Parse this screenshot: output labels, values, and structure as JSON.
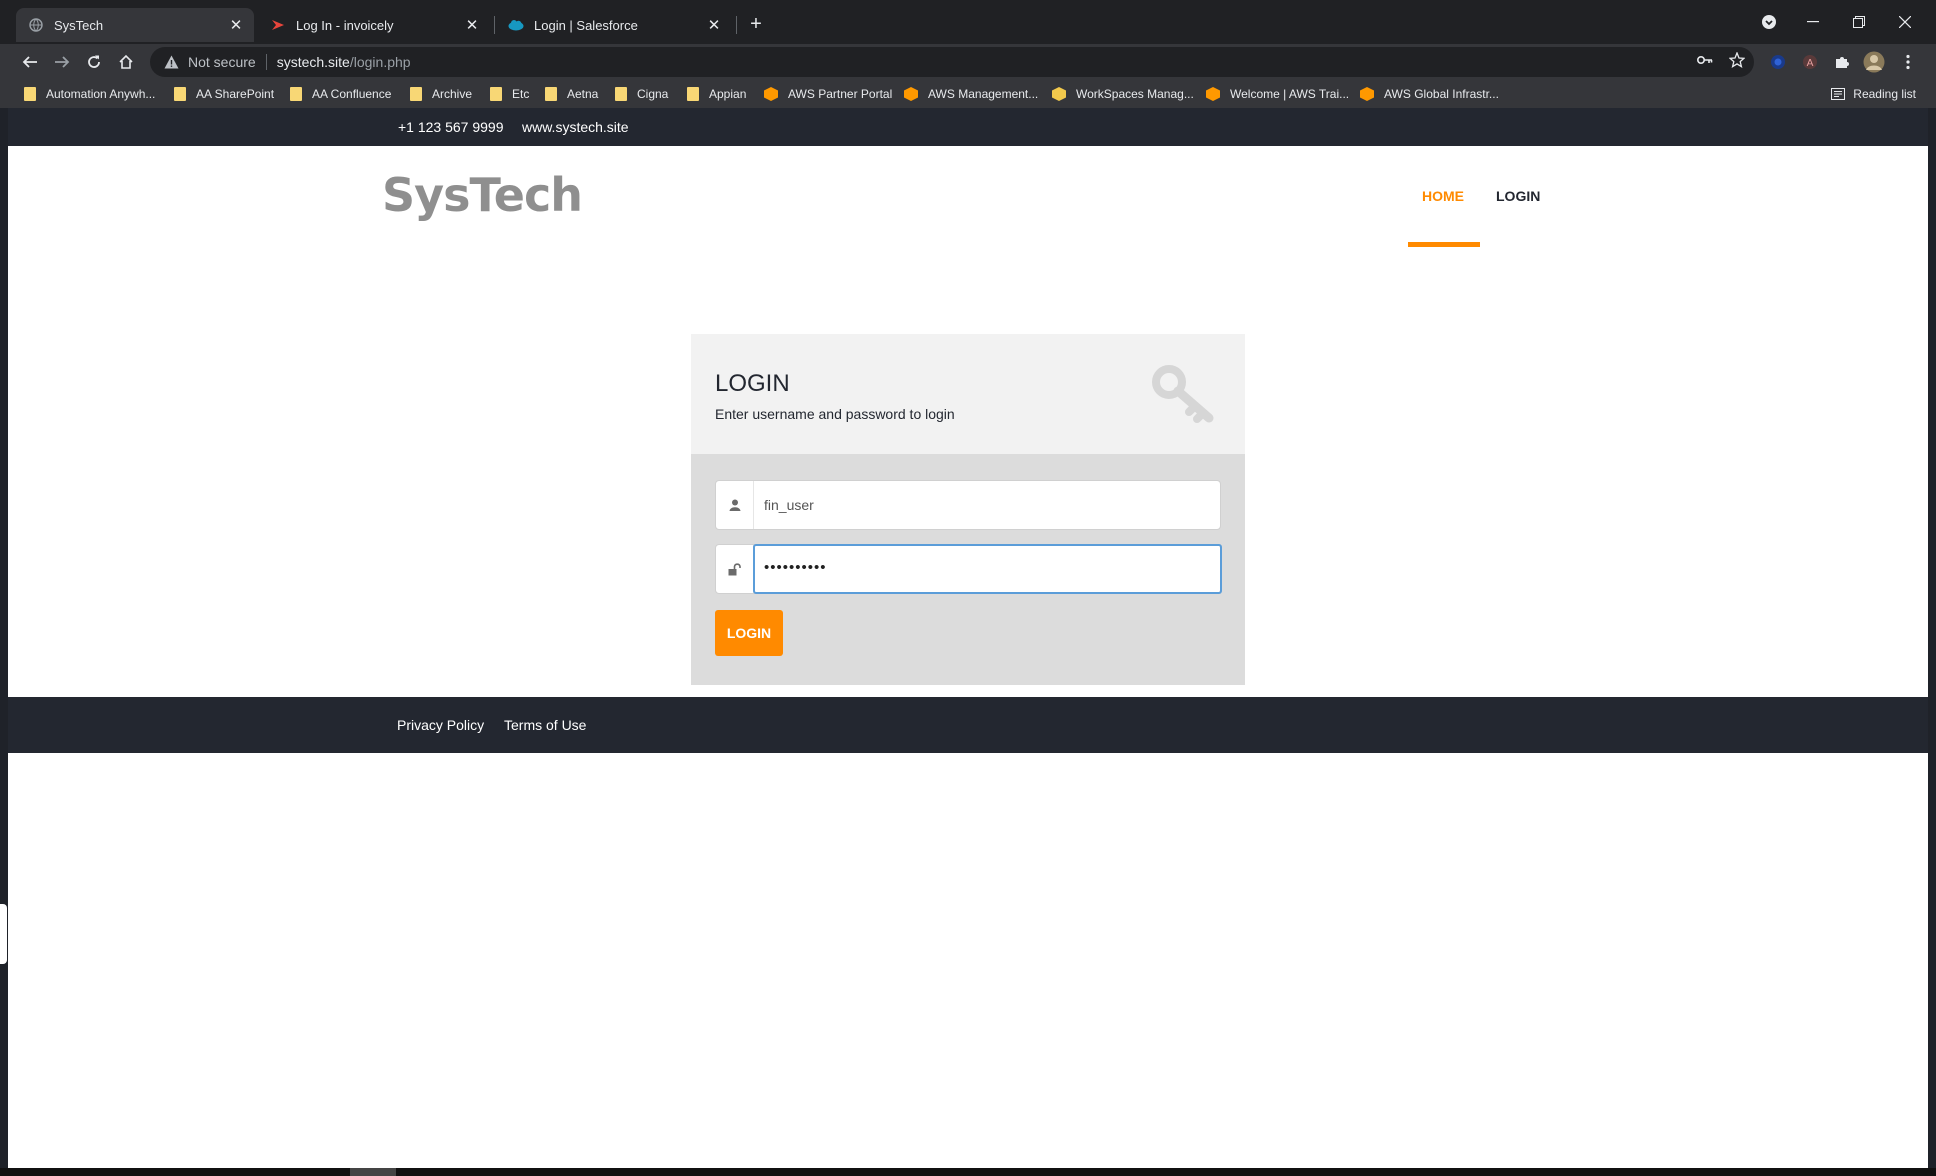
{
  "browser": {
    "tabs": [
      {
        "title": "SysTech",
        "favicon": "globe-icon",
        "active": true
      },
      {
        "title": "Log In - invoicely",
        "favicon": "invoicely-icon",
        "active": false
      },
      {
        "title": "Login | Salesforce",
        "favicon": "salesforce-cloud-icon",
        "active": false
      }
    ],
    "address": {
      "security_label": "Not secure",
      "host": "systech.site",
      "path": "/login.php"
    },
    "bookmarks": [
      {
        "label": "Automation Anywh...",
        "icon": "folder-icon"
      },
      {
        "label": "AA SharePoint",
        "icon": "folder-icon"
      },
      {
        "label": "AA Confluence",
        "icon": "folder-icon"
      },
      {
        "label": "Archive",
        "icon": "folder-icon"
      },
      {
        "label": "Etc",
        "icon": "folder-icon"
      },
      {
        "label": "Aetna",
        "icon": "folder-icon"
      },
      {
        "label": "Cigna",
        "icon": "folder-icon"
      },
      {
        "label": "Appian",
        "icon": "folder-icon"
      },
      {
        "label": "AWS Partner Portal",
        "icon": "aws-cube-icon"
      },
      {
        "label": "AWS Management...",
        "icon": "aws-cube-icon"
      },
      {
        "label": "WorkSpaces Manag...",
        "icon": "workspaces-cube-icon"
      },
      {
        "label": "Welcome | AWS Trai...",
        "icon": "aws-cube-icon"
      },
      {
        "label": "AWS Global Infrastr...",
        "icon": "aws-cube-icon"
      }
    ],
    "reading_list": "Reading list"
  },
  "page": {
    "topbar": {
      "phone": "+1 123 567 9999",
      "site": "www.systech.site"
    },
    "logo": "SysTech",
    "nav": {
      "home": "HOME",
      "login": "LOGIN"
    },
    "login": {
      "title": "LOGIN",
      "subtitle": "Enter username and password to login",
      "username": "fin_user",
      "password_masked": "••••••••••",
      "button": "LOGIN"
    },
    "footer": {
      "privacy": "Privacy Policy",
      "terms": "Terms of Use"
    }
  },
  "colors": {
    "accent": "#ff8a00",
    "dark": "#232730",
    "focus": "#5b9dd9"
  }
}
